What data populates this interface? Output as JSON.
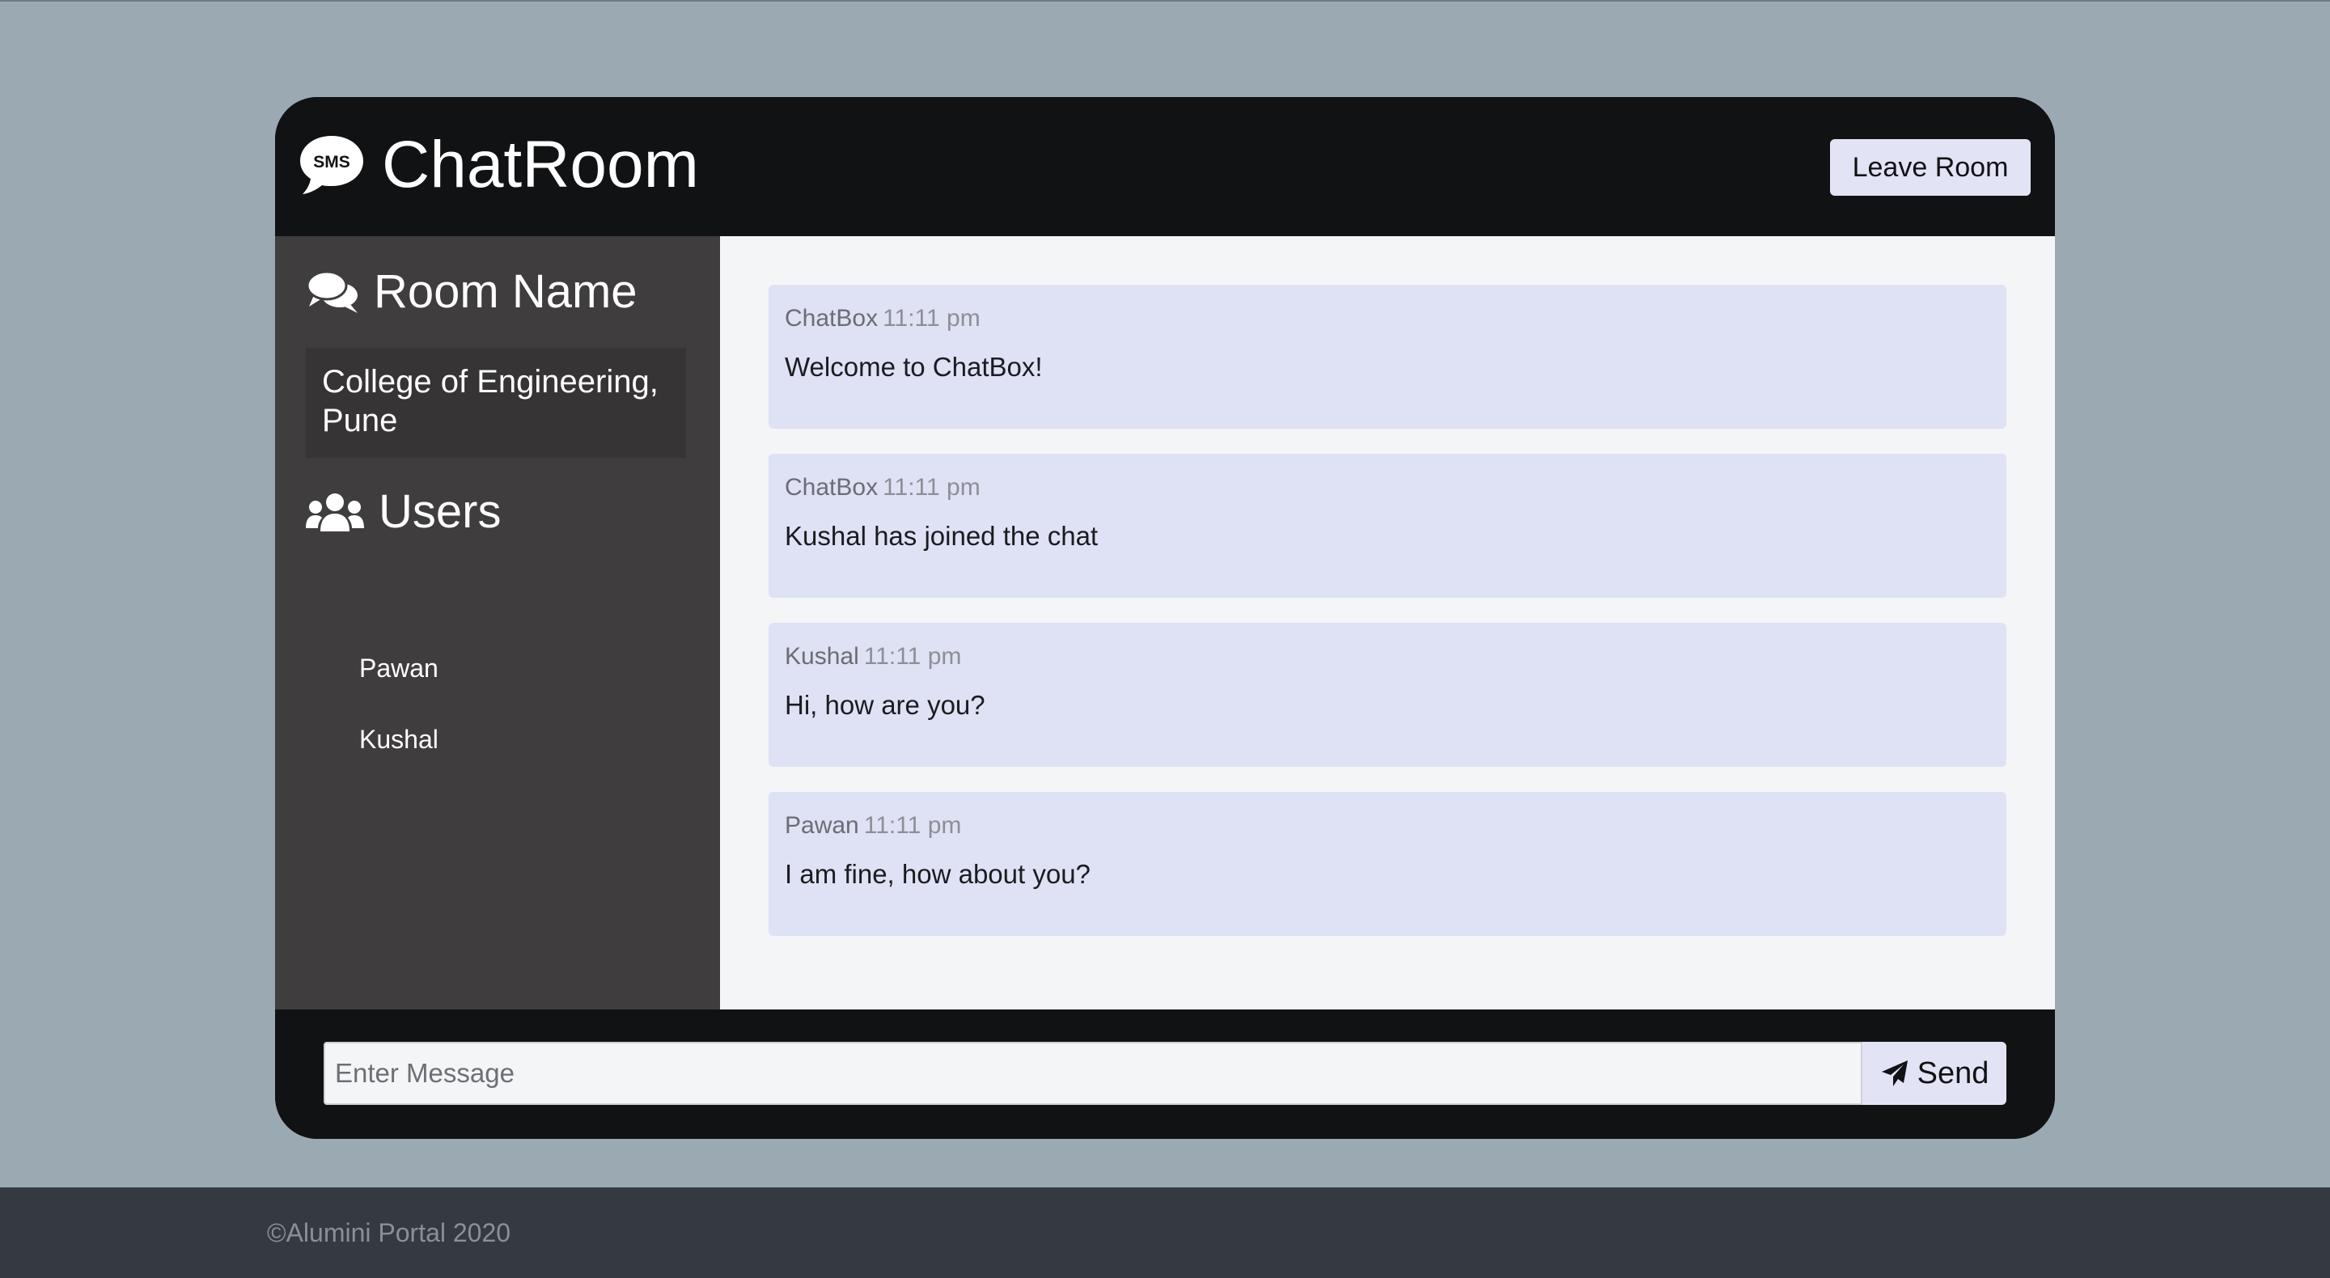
{
  "header": {
    "brand_icon": "sms-bubble-icon",
    "title": "ChatRoom",
    "leave_label": "Leave Room"
  },
  "sidebar": {
    "room_heading_icon": "comments-icon",
    "room_heading": "Room Name",
    "room_name": "College of Engineering, Pune",
    "users_heading_icon": "users-icon",
    "users_heading": "Users",
    "users": [
      "Pawan",
      "Kushal"
    ]
  },
  "messages": [
    {
      "user": "ChatBox",
      "time": "11:11 pm",
      "text": "Welcome to ChatBox!"
    },
    {
      "user": "ChatBox",
      "time": "11:11 pm",
      "text": "Kushal has joined the chat"
    },
    {
      "user": "Kushal",
      "time": "11:11 pm",
      "text": "Hi, how are you?"
    },
    {
      "user": "Pawan",
      "time": "11:11 pm",
      "text": "I am fine, how about you?"
    }
  ],
  "composer": {
    "placeholder": "Enter Message",
    "value": "",
    "send_icon": "paper-plane-icon",
    "send_label": "Send"
  },
  "footer": {
    "text": "©Alumini Portal 2020"
  },
  "colors": {
    "page_bg": "#9ba9b3",
    "container_bg": "#111214",
    "sidebar_bg": "#3f3d3e",
    "message_bg": "#dfe1f5",
    "button_bg": "#e3e3f6",
    "footer_bg": "#343a40"
  }
}
